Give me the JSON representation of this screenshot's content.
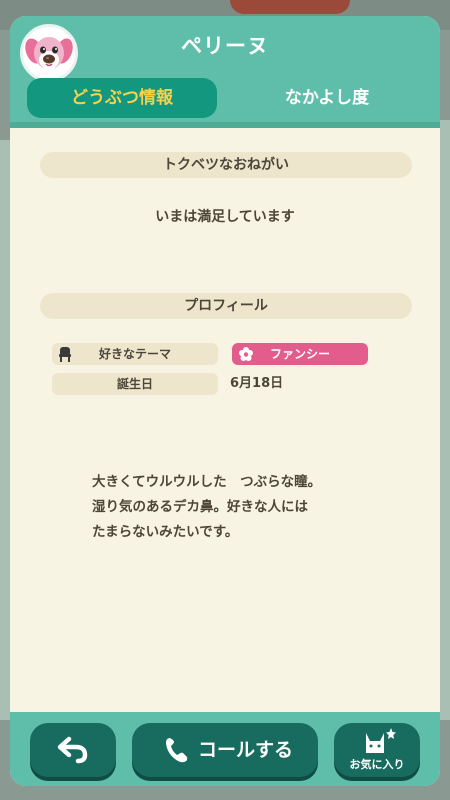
{
  "header": {
    "title": "ペリーヌ",
    "tabs": [
      {
        "label": "どうぶつ情報",
        "active": true
      },
      {
        "label": "なかよし度",
        "active": false
      }
    ]
  },
  "request": {
    "heading": "トクベツなおねがい",
    "text": "いまは満足しています"
  },
  "profile": {
    "heading": "プロフィール",
    "theme_label": "好きなテーマ",
    "theme_value": "ファンシー",
    "birthday_label": "誕生日",
    "birthday_value": "6月18日",
    "bio_lines": [
      "大きくてウルウルした　つぶらな瞳。",
      "湿り気のあるデカ鼻。好きな人には",
      "たまらないみたいです。"
    ]
  },
  "footer": {
    "call_label": "コールする",
    "favorite_label": "お気に入り"
  },
  "colors": {
    "accent": "#5fbea9",
    "tab_active_bg": "#13977f",
    "tab_active_text": "#f5d24b",
    "theme_pill": "#e25d8c",
    "button_bg": "#176b5f"
  },
  "icons": [
    "villager-avatar-icon",
    "chair-icon",
    "flower-icon",
    "back-arrow-icon",
    "phone-icon",
    "cat-star-icon"
  ]
}
